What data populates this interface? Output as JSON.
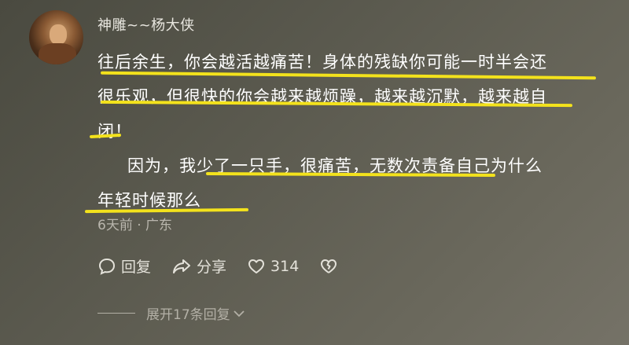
{
  "comment": {
    "username": "神雕~~杨大侠",
    "lines": [
      "往后余生，你会越活越痛苦！身体的残缺你可能一时半会还",
      "很乐观，但很快的你会越来越烦躁，越来越沉默，越来越自",
      "闭！",
      "因为，我少了一只手，很痛苦，无数次责备自己为什么",
      "年轻时候那么"
    ],
    "meta": "6天前 · 广东",
    "actions": {
      "reply_label": "回复",
      "share_label": "分享",
      "like_count": "314"
    },
    "expand_label": "展开17条回复",
    "highlight_color": "#f3e21c",
    "icons": [
      "reply-icon",
      "share-icon",
      "heart-icon",
      "broken-heart-icon",
      "chevron-down-icon"
    ]
  }
}
